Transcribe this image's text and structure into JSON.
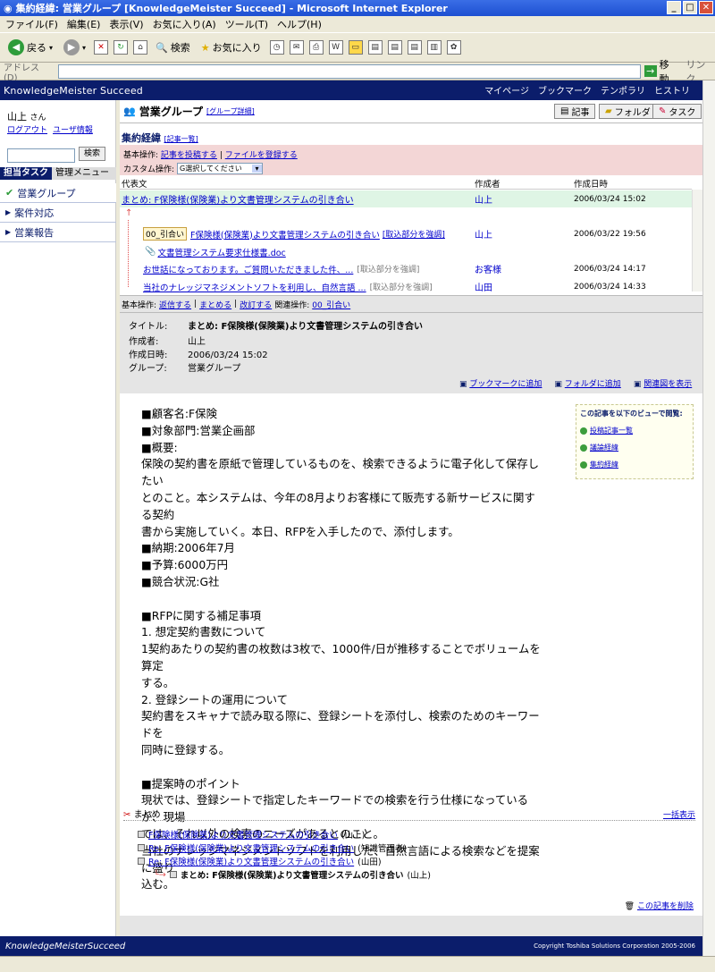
{
  "window": {
    "title": "集約経緯: 営業グループ [KnowledgeMeister Succeed] - Microsoft Internet Explorer"
  },
  "menu": [
    "ファイル(F)",
    "編集(E)",
    "表示(V)",
    "お気に入り(A)",
    "ツール(T)",
    "ヘルプ(H)"
  ],
  "toolbar": {
    "back": "戻る",
    "search": "検索",
    "favorites": "お気に入り"
  },
  "address": {
    "label": "アドレス(D)",
    "go": "移動",
    "links": "リンク"
  },
  "app": {
    "logo": "KnowledgeMeister Succeed",
    "nav": [
      "マイページ",
      "ブックマーク",
      "テンポラリ",
      "ヒストリ"
    ]
  },
  "left": {
    "user": "山上",
    "user_suffix": "さん",
    "logout": "ログアウト",
    "userinfo": "ユーザ情報",
    "search_btn": "検索",
    "tab_active": "担当タスク",
    "tab_other": "管理メニュー",
    "items": [
      "営業グループ",
      "案件対応",
      "営業報告"
    ]
  },
  "main": {
    "group_title": "営業グループ",
    "group_detail": "[グループ詳細]",
    "btn_article": "記事",
    "btn_folder": "フォルダ",
    "btn_task": "タスク",
    "section_title": "集約経緯",
    "section_link": "[記事一覧]",
    "ops_label": "基本操作:",
    "ops_post": "記事を投稿する",
    "ops_sep": "|",
    "ops_file": "ファイルを登録する",
    "custom_label": "カスタム操作:",
    "custom_select": "G選択してください",
    "cols": [
      "代表文",
      "作成者",
      "作成日時"
    ],
    "rows": [
      {
        "title": "まとめ: F保険様(保険業)より文書管理システムの引き合い",
        "author": "山上",
        "date": "2006/03/24 15:02"
      },
      {
        "quote": "00_引合い",
        "title": "F保険様(保険業)より文書管理システムの引き合い",
        "tag": "[取込部分を強調]",
        "author": "山上",
        "date": "2006/03/22 19:56"
      },
      {
        "title": "文書管理システム要求仕様書.doc",
        "author": "",
        "date": ""
      },
      {
        "title": "お世話になっております。ご質問いただきました件、...",
        "tag": "[取込部分を強調]",
        "author": "お客様",
        "date": "2006/03/24 14:17"
      },
      {
        "title": "当社のナレッジマネジメントソフトを利用し、自然言語 ...",
        "tag": "[取込部分を強調]",
        "author": "山田",
        "date": "2006/03/24 14:33"
      }
    ],
    "basic_ops": "基本操作:",
    "reply": "返信する",
    "summarize": "まとめる",
    "revise": "改訂する",
    "related": "関連操作:",
    "inquiry": "00_引合い",
    "detail": [
      {
        "k": "タイトル:",
        "v": "まとめ: F保険様(保険業)より文書管理システムの引き合い"
      },
      {
        "k": "作成者:",
        "v": "山上"
      },
      {
        "k": "作成日時:",
        "v": "2006/03/24 15:02"
      },
      {
        "k": "グループ:",
        "v": "営業グループ"
      }
    ],
    "add_bookmark": "ブックマークに追加",
    "add_folder": "フォルダに追加",
    "show_related": "関連図を表示",
    "body": [
      "■顧客名:F保険",
      "■対象部門:営業企画部",
      "■概要:",
      "保険の契約書を原紙で管理しているものを、検索できるように電子化して保存したい",
      "とのこと。本システムは、今年の8月よりお客様にて販売する新サービスに関する契約",
      "書から実施していく。本日、RFPを入手したので、添付します。",
      "■納期:2006年7月",
      "■予算:6000万円",
      "■競合状況:G社",
      "",
      "■RFPに関する補足事項",
      "1. 想定契約書数について",
      "1契約あたりの契約書の枚数は3枚で、1000件/日が推移することでボリュームを算定",
      "する。",
      "2. 登録シートの運用について",
      "契約書をスキャナで読み取る際に、登録シートを添付し、検索のためのキーワードを",
      "同時に登録する。",
      "",
      "■提案時のポイント",
      "現状では、登録シートで指定したキーワードでの検索を行う仕様になっているが、現場",
      "では、それ以外の検索のニーズがあるとのこと。",
      "当社のナレッジマネジメントソフトを利用した、自然言語による検索などを提案に盛り",
      "込む。"
    ],
    "view_title": "この記事を以下のビューで閲覧:",
    "views": [
      "投稿記事一覧",
      "議論経緯",
      "集約経緯"
    ],
    "summary_label": "まとめ",
    "show_all": "一括表示",
    "thread": [
      {
        "t": "F保険様(保険業)より文書管理システムの引き合い",
        "a": "(山上)"
      },
      {
        "t": "Re: F保険様(保険業)より文書管理システムの引き合い",
        "a": "(知識管理者)"
      },
      {
        "t": "Re: F保険様(保険業)より文書管理システムの引き合い",
        "a": "(山田)"
      },
      {
        "t": "まとめ: F保険様(保険業)より文書管理システムの引き合い",
        "a": "(山上)"
      }
    ],
    "delete": "この記事を削除"
  },
  "footer": {
    "logo": "KnowledgeMeisterSucceed",
    "copyright": "Copyright Toshiba Solutions Corporation 2005-2006"
  }
}
